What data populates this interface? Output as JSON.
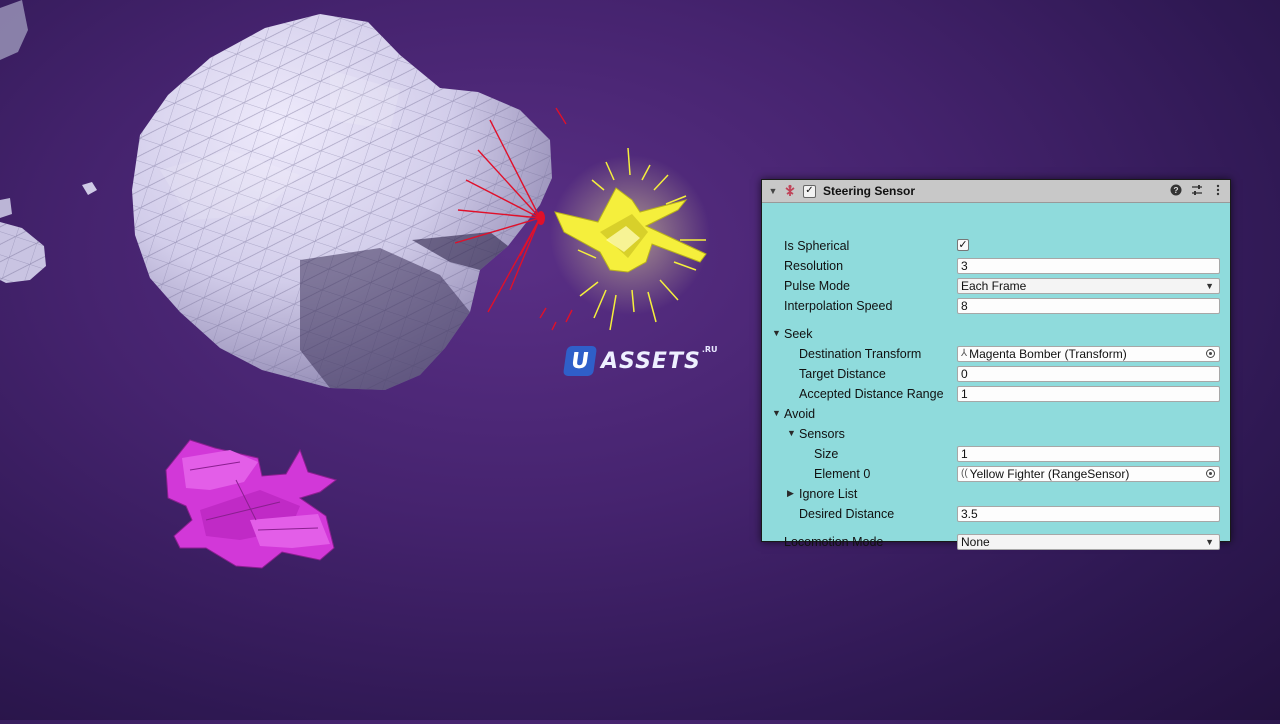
{
  "watermark": {
    "badge": "U",
    "text": "ASSETS",
    "sup": ".RU"
  },
  "inspector": {
    "title": "Steering Sensor",
    "enabled": true,
    "header_icons": [
      "help-icon",
      "settings-sliders-icon",
      "kebab-menu-icon"
    ],
    "rows": {
      "is_spherical": {
        "label": "Is Spherical",
        "checked": true,
        "mark": "✓"
      },
      "resolution": {
        "label": "Resolution",
        "value": "3"
      },
      "pulse_mode": {
        "label": "Pulse Mode",
        "value": "Each Frame"
      },
      "interpolation_speed": {
        "label": "Interpolation Speed",
        "value": "8"
      },
      "seek": {
        "label": "Seek"
      },
      "destination_transform": {
        "label": "Destination Transform",
        "value": "Magenta Bomber (Transform)"
      },
      "target_distance": {
        "label": "Target Distance",
        "value": "0"
      },
      "accepted_distance_range": {
        "label": "Accepted Distance Range",
        "value": "1"
      },
      "avoid": {
        "label": "Avoid"
      },
      "sensors": {
        "label": "Sensors"
      },
      "size": {
        "label": "Size",
        "value": "1"
      },
      "element_0": {
        "label": "Element 0",
        "value": "Yellow Fighter (RangeSensor)"
      },
      "ignore_list": {
        "label": "Ignore List"
      },
      "desired_distance": {
        "label": "Desired Distance",
        "value": "3.5"
      },
      "locomotion_mode": {
        "label": "Locomotion Mode",
        "value": "None"
      }
    }
  },
  "colors": {
    "background": "#45236e",
    "panel": "#8fdbdc",
    "header": "#c8c8c8",
    "yellow_ship": "#f5ef3c",
    "magenta_ship": "#d238d8",
    "asteroid": "#d7d3ee",
    "ray": "#e0102a"
  }
}
